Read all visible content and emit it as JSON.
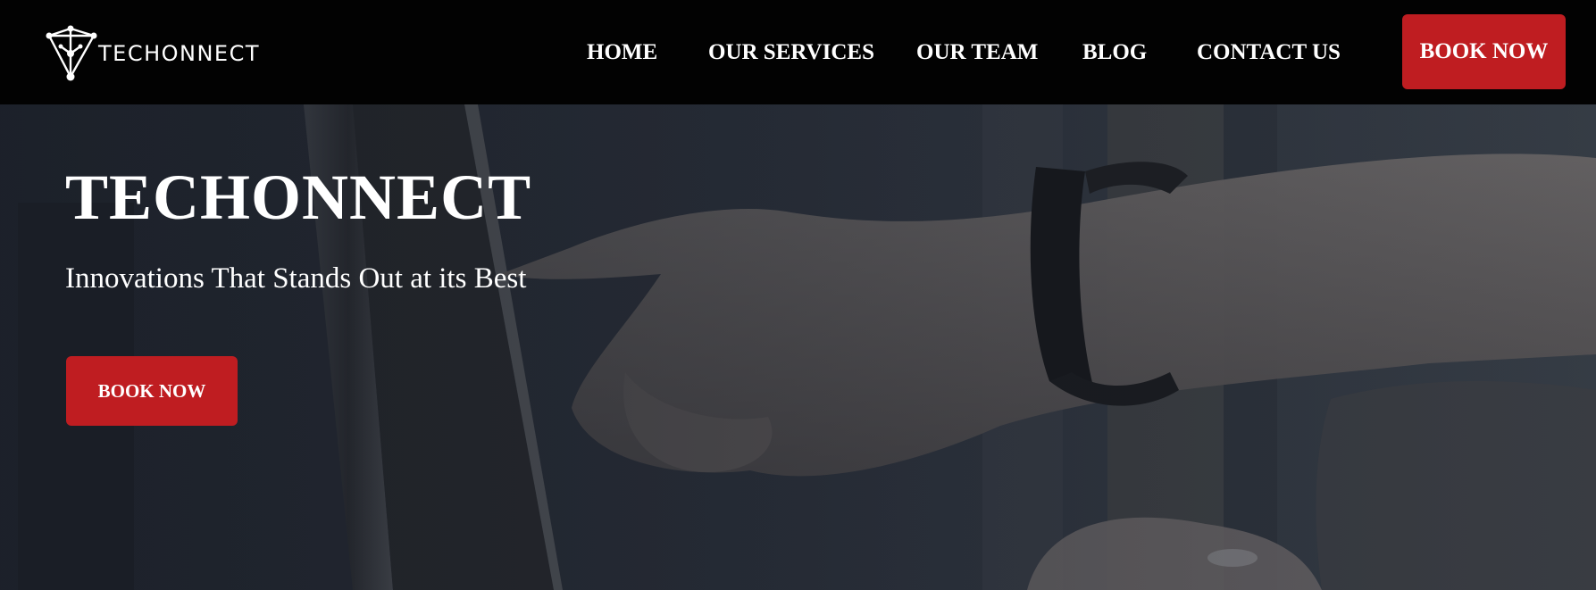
{
  "brand": {
    "name": "TECHONNECT",
    "logo_icon": "network-triangle-icon"
  },
  "nav": {
    "items": [
      {
        "label": "HOME"
      },
      {
        "label": "OUR SERVICES"
      },
      {
        "label": "OUR TEAM"
      },
      {
        "label": "BLOG"
      },
      {
        "label": "CONTACT US"
      }
    ],
    "cta_label": "BOOK NOW"
  },
  "hero": {
    "title": "TECHONNECT",
    "subtitle": "Innovations That Stands Out at its Best",
    "cta_label": "BOOK NOW",
    "image_description_icon": "hand-touching-screen-photo"
  },
  "colors": {
    "header_bg": "#020202",
    "accent": "#bf1d21",
    "hero_tint": "#2b313c",
    "text": "#ffffff"
  }
}
